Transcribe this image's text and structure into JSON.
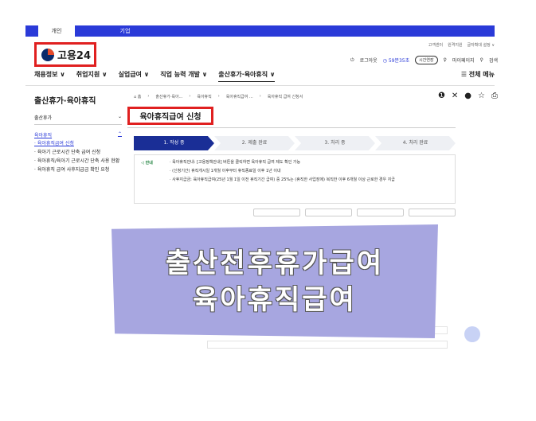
{
  "topbar": {
    "tab_personal": "개인",
    "tab_corporate": "기업"
  },
  "utility": [
    "고객센터",
    "원격지원",
    "글자확대 설정 ∨"
  ],
  "logo": {
    "text": "고용24"
  },
  "account": {
    "logout": "로그아웃",
    "timer": "59분35초",
    "extend": "시간연장",
    "mypage": "마이페이지",
    "search": "검색"
  },
  "gnb": {
    "items": [
      "채용정보 ∨",
      "취업지원 ∨",
      "실업급여 ∨",
      "직업 능력 개발 ∨",
      "출산휴가·육아휴직 ∨"
    ],
    "all_menu": "☰ 전체 메뉴"
  },
  "lnb": {
    "title": "출산휴가·육아휴직",
    "group": "출산휴가",
    "sub_head": "육아휴직",
    "entries": [
      "· 육아휴직급여 신청",
      "· 육아기 근로시간 단축 급여 신청",
      "· 육아휴직/육아기 근로시간 단축 사용 현황",
      "· 육아휴직 급여 사후지급금 확인 요청"
    ]
  },
  "breadcrumb": [
    "⌂ 홈",
    "›",
    "출산휴가·육아...",
    "›",
    "육아휴직",
    "›",
    "육아휴직급여 ...",
    "›",
    "육아휴직 급여 신청서"
  ],
  "page_title": "육아휴직급여 신청",
  "steps": [
    "1. 작성 중",
    "2. 제출 완료",
    "3. 처리 중",
    "4. 처리 완료"
  ],
  "notice": {
    "label": "안내",
    "lines": [
      "· 육아휴직안내: [고용정책안내] 버튼을 클릭하면 육아휴직 급여 제도 확인 가능",
      "· (신청기간) 휴직개시일 1개월 이후부터 휴직종료일 이후 1년 이내",
      "· 사후지급금: 육아휴직급여(25년 1월 1일 이전 휴직기간 급여) 중 25%는 (휴직한 사업장에) 복직한 이후 6개월 이상 근로한 경우 지급"
    ]
  },
  "banner": {
    "line1": "출산전후휴가급여",
    "line2": "육아휴직급여"
  }
}
